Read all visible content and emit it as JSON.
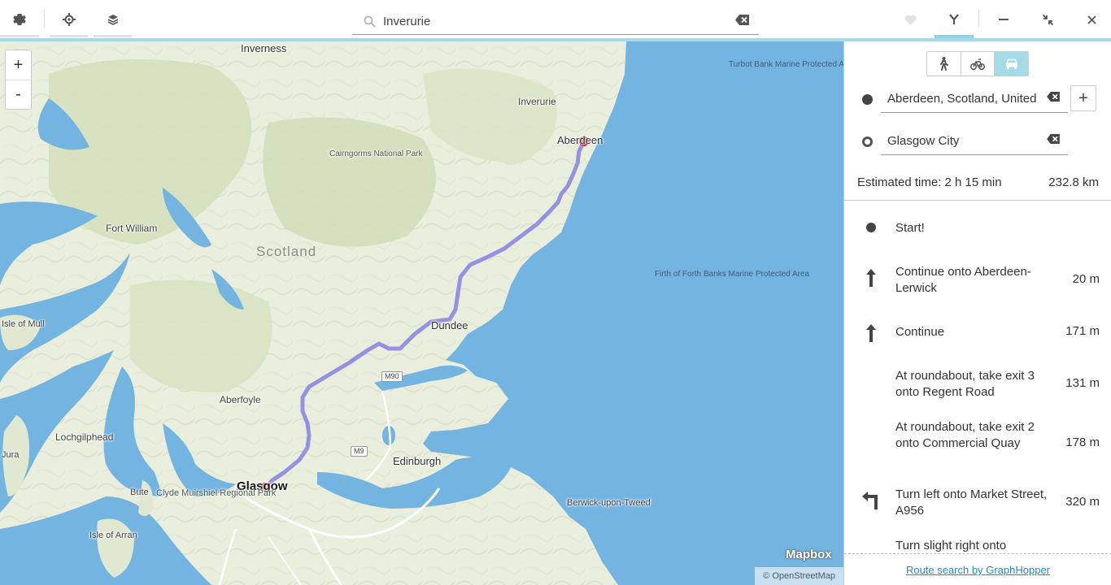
{
  "header": {
    "search_value": "Inverurie",
    "buttons": {
      "settings": "gear-icon",
      "locate": "crosshair-icon",
      "layers": "layers-icon",
      "favorite": "heart-icon",
      "route": "route-icon",
      "minimize": "minimize-icon",
      "restore": "restore-icon",
      "close": "close-icon"
    }
  },
  "map": {
    "zoom_in": "+",
    "zoom_out": "-",
    "labels": {
      "inverness": "Inverness",
      "inverurie": "Inverurie",
      "aberdeen": "Aberdeen",
      "cairngorms": "Cairngorms National Park",
      "fort_william": "Fort William",
      "scotland": "Scotland",
      "isle_of_mull": "Isle of Mull",
      "dundee": "Dundee",
      "aberfoyle": "Aberfoyle",
      "lochgilphead": "Lochgilphead",
      "jura": "Jura",
      "glasgow": "Glasgow",
      "bute": "Bute",
      "clyde_muirshiel": "Clyde Muirshiel Regional Park",
      "edinburgh": "Edinburgh",
      "isle_of_arran": "Isle of Arran",
      "berwick": "Berwick-upon-Tweed",
      "turbot_bank": "Turbot Bank Marine Protected Area",
      "firth_of_forth": "Firth of Forth Banks Marine Protected Area",
      "m90": "M90",
      "m9": "M9"
    },
    "logo": "Mapbox",
    "attribution": "© OpenStreetMap",
    "colors": {
      "water": "#74b4e0",
      "land": "#e9eddc",
      "forest": "#c8d8ae",
      "route": "#8c86e6",
      "marker": "#e02020"
    }
  },
  "sidebar": {
    "modes": [
      "walk-icon",
      "bike-icon",
      "car-icon"
    ],
    "active_mode": "car",
    "from": "Aberdeen, Scotland, United",
    "to": "Glasgow City",
    "add_waypoint": "+",
    "estimated_time": "Estimated time: 2 h 15 min",
    "distance": "232.8 km",
    "instructions": [
      {
        "icon": "dot-icon",
        "text": "Start!",
        "distance": ""
      },
      {
        "icon": "arrow-up-icon",
        "text": "Continue onto Aberdeen-Lerwick",
        "distance": "20 m"
      },
      {
        "icon": "arrow-up-icon",
        "text": "Continue",
        "distance": "171 m"
      },
      {
        "icon": "",
        "text": "At roundabout, take exit 3 onto Regent Road",
        "distance": "131 m"
      },
      {
        "icon": "",
        "text": "At roundabout, take exit 2 onto Commercial Quay",
        "distance": "178 m"
      },
      {
        "icon": "turn-left-icon",
        "text": "Turn left onto Market Street, A956",
        "distance": "320 m"
      },
      {
        "icon": "turn-slight-right-icon",
        "text": "Turn slight right onto",
        "distance": ""
      }
    ],
    "footer_link": "Route search by GraphHopper"
  }
}
